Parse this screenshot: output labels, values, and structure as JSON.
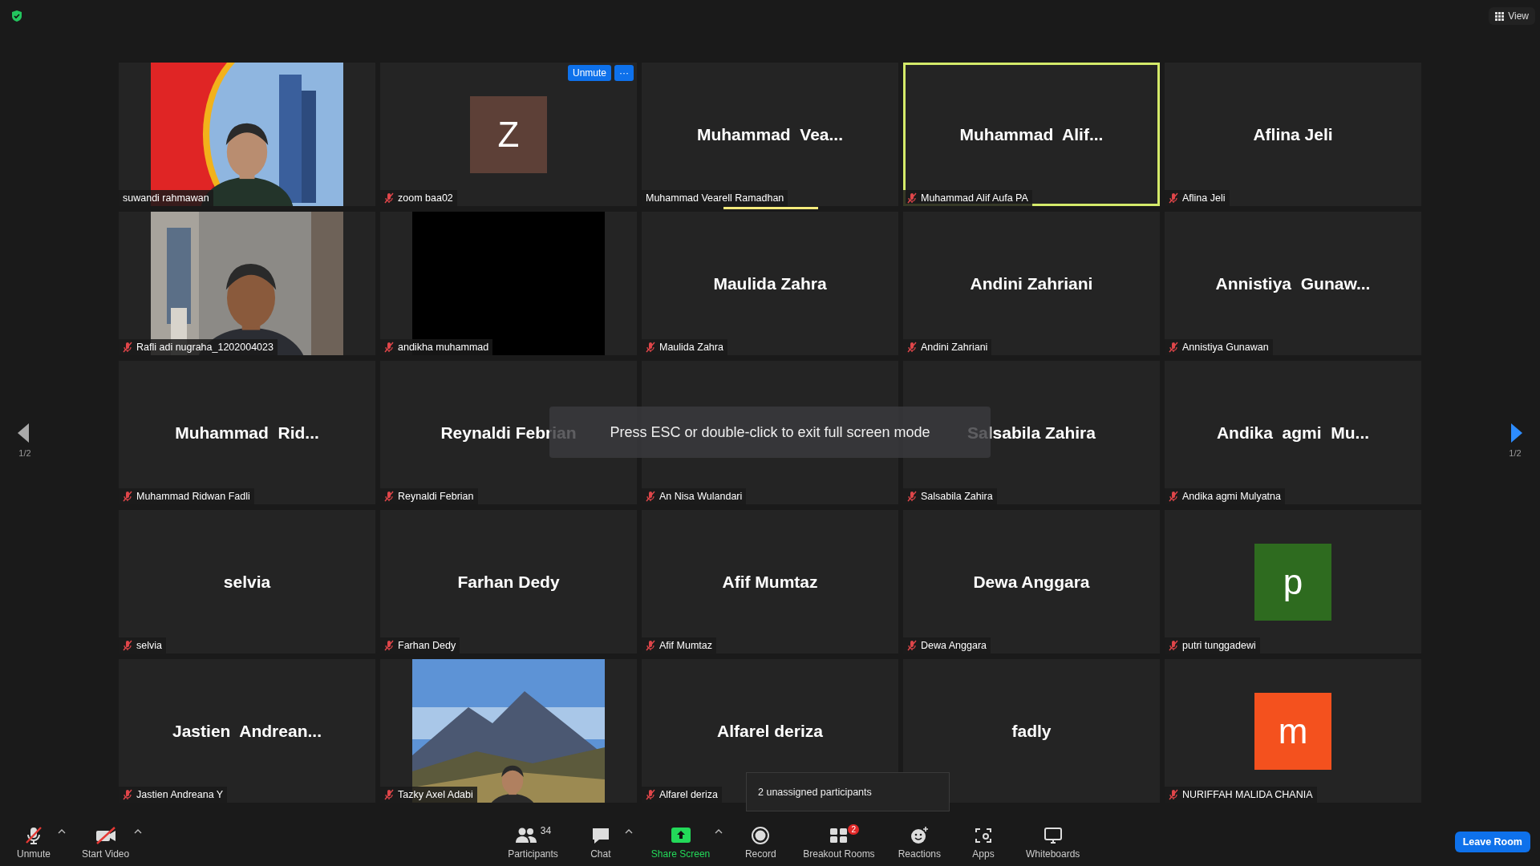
{
  "top_bar": {
    "view_button": "View"
  },
  "pager": {
    "left_label": "1/2",
    "right_label": "1/2"
  },
  "tiles": [
    {
      "kind": "video-person-slide",
      "name": "suwandi rahmawan",
      "muted": false
    },
    {
      "kind": "avatar",
      "letter": "Z",
      "color": "#5d4037",
      "name": "zoom baa02",
      "muted": true,
      "hover_controls": {
        "unmute": "Unmute",
        "more": "···"
      }
    },
    {
      "kind": "name",
      "display": "Muhammad  Vea...",
      "name": "Muhammad Vearell Ramadhan",
      "muted": false,
      "speaking": true
    },
    {
      "kind": "name",
      "display": "Muhammad  Alif...",
      "name": "Muhammad Alif Aufa PA",
      "muted": true,
      "highlighted": true
    },
    {
      "kind": "name",
      "display": "Aflina Jeli",
      "name": "Aflina Jeli",
      "muted": true
    },
    {
      "kind": "video-person-room",
      "name": "Rafli adi nugraha_1202004023",
      "muted": true
    },
    {
      "kind": "video-dark",
      "name": "andikha muhammad",
      "muted": true
    },
    {
      "kind": "name",
      "display": "Maulida Zahra",
      "name": "Maulida Zahra",
      "muted": true
    },
    {
      "kind": "name",
      "display": "Andini Zahriani",
      "name": "Andini Zahriani",
      "muted": true
    },
    {
      "kind": "name",
      "display": "Annistiya  Gunaw...",
      "name": "Annistiya Gunawan",
      "muted": true
    },
    {
      "kind": "name",
      "display": "Muhammad  Rid...",
      "name": "Muhammad Ridwan Fadli",
      "muted": true
    },
    {
      "kind": "name",
      "display": "Reynaldi Febrian",
      "name": "Reynaldi Febrian",
      "muted": true
    },
    {
      "kind": "blank",
      "name": "An Nisa Wulandari",
      "muted": true
    },
    {
      "kind": "name",
      "display": "Salsabila Zahira",
      "name": "Salsabila Zahira",
      "muted": true
    },
    {
      "kind": "name",
      "display": "Andika  agmi  Mu...",
      "name": "Andika agmi Mulyatna",
      "muted": true
    },
    {
      "kind": "name",
      "display": "selvia",
      "name": "selvia",
      "muted": true
    },
    {
      "kind": "name",
      "display": "Farhan Dedy",
      "name": "Farhan Dedy",
      "muted": true
    },
    {
      "kind": "name",
      "display": "Afif Mumtaz",
      "name": "Afif Mumtaz",
      "muted": true
    },
    {
      "kind": "name",
      "display": "Dewa Anggara",
      "name": "Dewa Anggara",
      "muted": true
    },
    {
      "kind": "avatar",
      "letter": "p",
      "color": "#2e6b1f",
      "name": "putri tunggadewi",
      "muted": true
    },
    {
      "kind": "name",
      "display": "Jastien  Andrean...",
      "name": "Jastien Andreana Y",
      "muted": true
    },
    {
      "kind": "video-person-mountain",
      "name": "Tazky Axel Adabi",
      "muted": true
    },
    {
      "kind": "name",
      "display": "Alfarel deriza",
      "name": "Alfarel deriza",
      "muted": true
    },
    {
      "kind": "name",
      "display": "fadly"
    },
    {
      "kind": "avatar",
      "letter": "m",
      "color": "#f4511e",
      "name": "NURIFFAH MALIDA CHANIA",
      "muted": true
    }
  ],
  "fullscreen_hint": "Press ESC or double-click to exit full screen mode",
  "tooltip": "2 unassigned participants",
  "toolbar": {
    "left": [
      {
        "kind": "mic",
        "label": "Unmute",
        "caret": true
      },
      {
        "kind": "video",
        "label": "Start Video",
        "caret": true
      }
    ],
    "center": [
      {
        "kind": "participants",
        "label": "Participants",
        "count": "34"
      },
      {
        "kind": "chat",
        "label": "Chat",
        "caret": true
      },
      {
        "kind": "share",
        "label": "Share Screen",
        "caret": true,
        "accent": true
      },
      {
        "kind": "record",
        "label": "Record"
      },
      {
        "kind": "breakout",
        "label": "Breakout Rooms",
        "badge": "2"
      },
      {
        "kind": "reactions",
        "label": "Reactions"
      },
      {
        "kind": "apps",
        "label": "Apps"
      },
      {
        "kind": "whiteboard",
        "label": "Whiteboards"
      }
    ],
    "leave_button": "Leave Room"
  }
}
